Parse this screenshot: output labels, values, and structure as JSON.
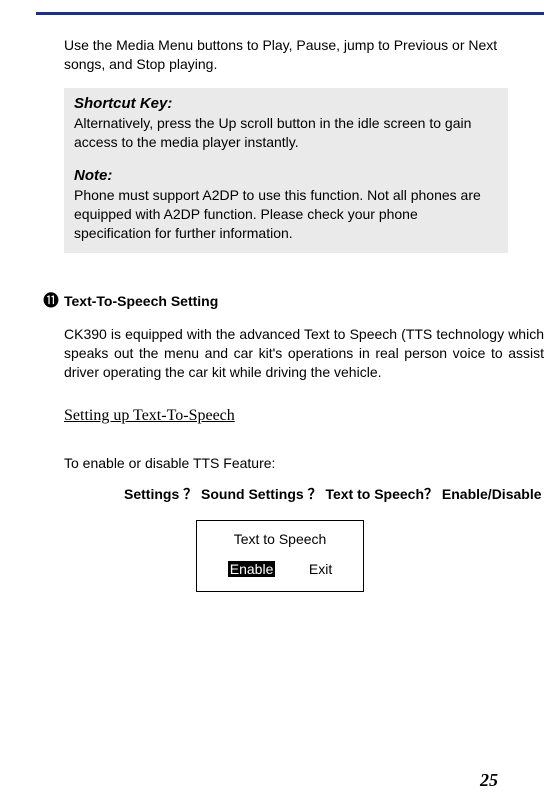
{
  "intro": "Use the Media Menu buttons to Play, Pause, jump to Previous or Next songs, and Stop playing.",
  "box": {
    "shortcut_heading": "Shortcut Key:",
    "shortcut_text": "Alternatively, press the Up scroll button in the idle screen to gain access to the media player instantly.",
    "note_heading": "Note:",
    "note_text": "Phone must support A2DP to use this function. Not all phones are equipped with A2DP function. Please check your phone specification for further information."
  },
  "bullet_glyph": "⓫",
  "tts_heading": "Text-To-Speech Setting",
  "tts_paragraph": "CK390 is equipped with the advanced Text to Speech (TTS technology which speaks out the menu and car kit's operations in real person voice to assist driver operating the car kit while driving the vehicle.",
  "setup_heading": "Setting up Text-To-Speech",
  "enable_intro": "To enable or disable TTS Feature:",
  "path": {
    "s1": "Settings",
    "q": "？",
    "s2": "Sound Settings",
    "s3": "Text to Speech",
    "s4": "Enable/Disable"
  },
  "device": {
    "title": "Text to Speech",
    "enable": "Enable",
    "exit": "Exit"
  },
  "page_number": "25"
}
